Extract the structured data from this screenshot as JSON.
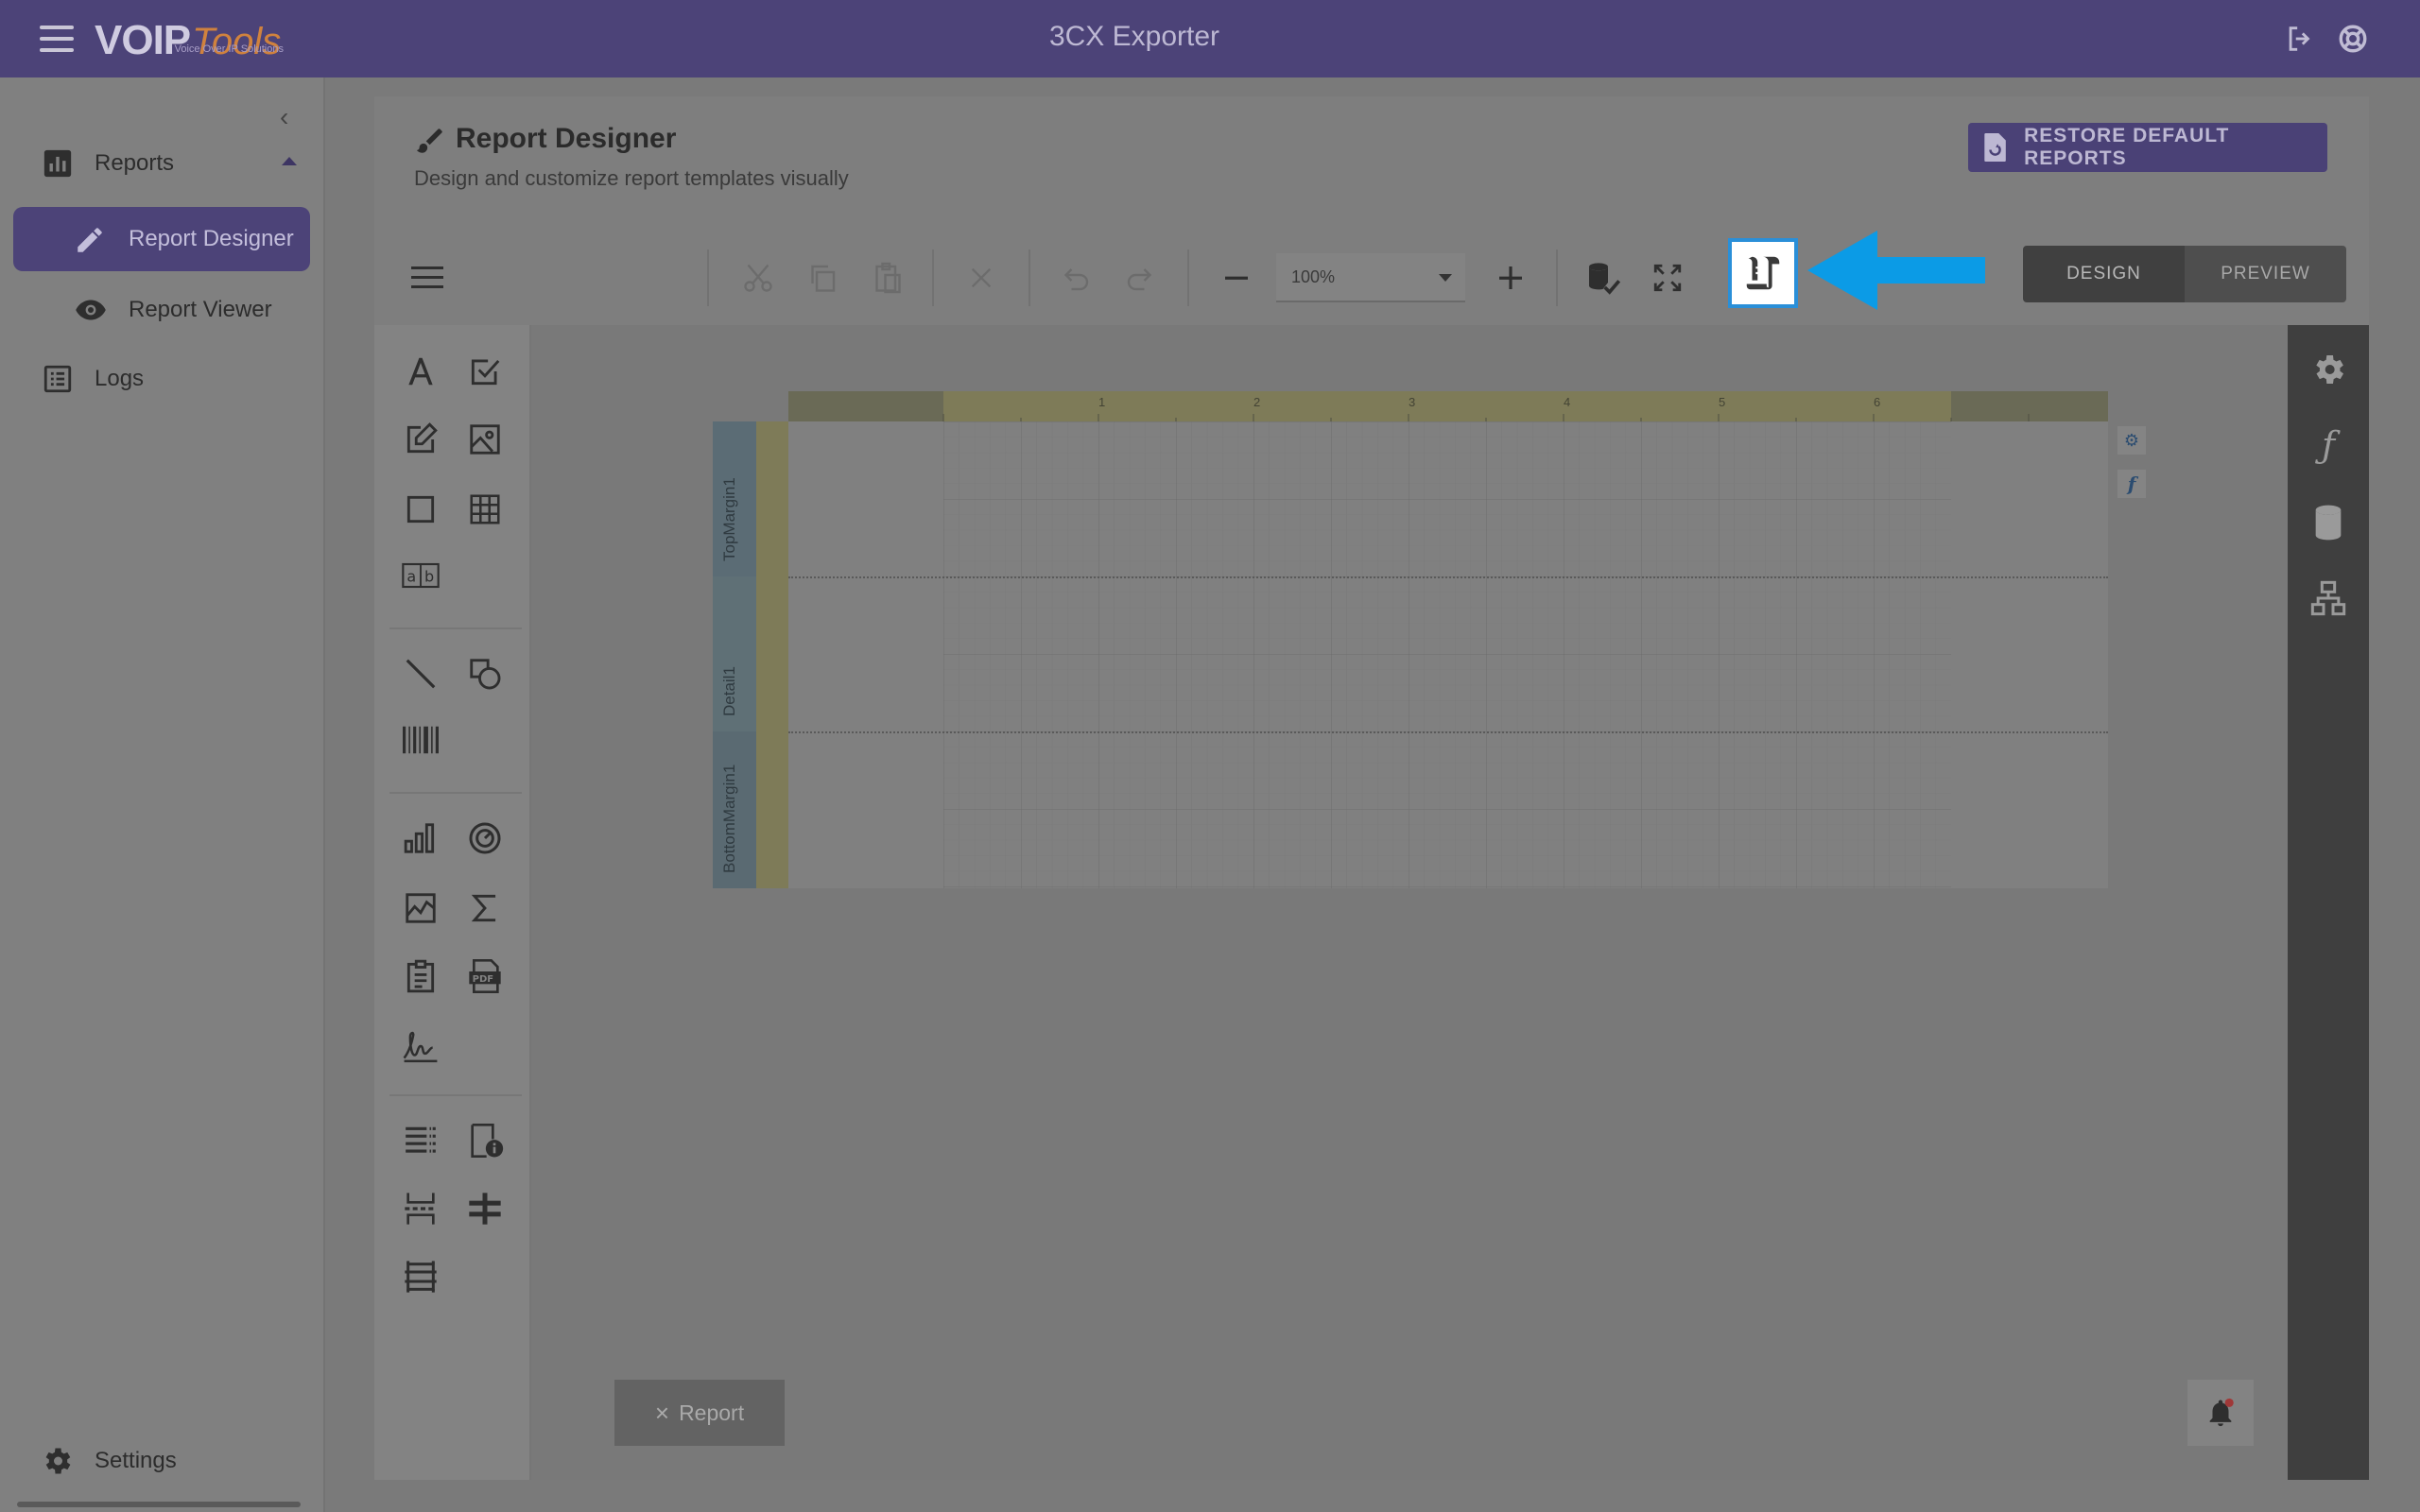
{
  "header": {
    "logo_main": "VOIP",
    "logo_accent": "Tools",
    "logo_tagline": "Voice Over IP Solutions",
    "title": "3CX Exporter",
    "icons": [
      "menu-icon",
      "logout-icon",
      "support-icon"
    ]
  },
  "sidebar": {
    "items": [
      {
        "label": "Reports",
        "icon": "bar-chart-icon"
      },
      {
        "label": "Report Designer",
        "icon": "pencil-icon",
        "active": true
      },
      {
        "label": "Report Viewer",
        "icon": "eye-icon"
      },
      {
        "label": "Logs",
        "icon": "list-icon"
      }
    ],
    "footer_label": "Settings"
  },
  "page": {
    "title": "Report Designer",
    "subtitle": "Design and customize report templates visually",
    "restore_button": "RESTORE DEFAULT REPORTS"
  },
  "toolbar": {
    "zoom": "100%",
    "mode_design": "DESIGN",
    "mode_preview": "PREVIEW"
  },
  "report": {
    "bands": [
      "TopMargin1",
      "Detail1",
      "BottomMargin1"
    ],
    "ruler_ticks": [
      "1",
      "2",
      "3",
      "4",
      "5",
      "6"
    ],
    "tab_label": "Report"
  },
  "colors": {
    "brand": "#4c4378",
    "highlight": "#2a8fd8",
    "arrow": "#0b9be6"
  }
}
